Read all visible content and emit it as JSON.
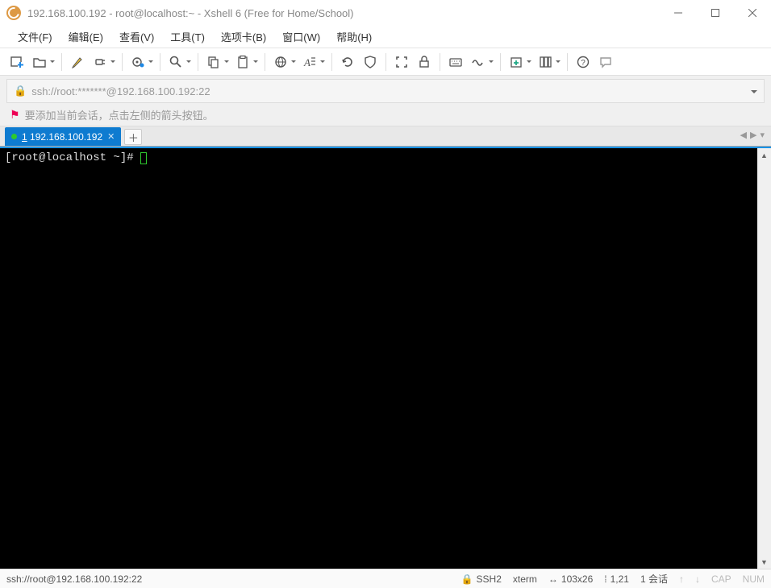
{
  "titlebar": {
    "title": "192.168.100.192 - root@localhost:~ - Xshell 6 (Free for Home/School)"
  },
  "menus": [
    {
      "label": "文件(F)"
    },
    {
      "label": "编辑(E)"
    },
    {
      "label": "查看(V)"
    },
    {
      "label": "工具(T)"
    },
    {
      "label": "选项卡(B)"
    },
    {
      "label": "窗口(W)"
    },
    {
      "label": "帮助(H)"
    }
  ],
  "address": {
    "text": "ssh://root:*******@192.168.100.192:22"
  },
  "info": {
    "text": "要添加当前会话，点击左侧的箭头按钮。"
  },
  "tab": {
    "num": "1",
    "label": "192.168.100.192"
  },
  "terminal": {
    "prompt": "[root@localhost ~]# "
  },
  "status": {
    "path": "ssh://root@192.168.100.192:22",
    "ssh": "SSH2",
    "term": "xterm",
    "size": "103x26",
    "pos": "1,21",
    "sessions": "1 会话",
    "cap": "CAP",
    "num": "NUM"
  }
}
